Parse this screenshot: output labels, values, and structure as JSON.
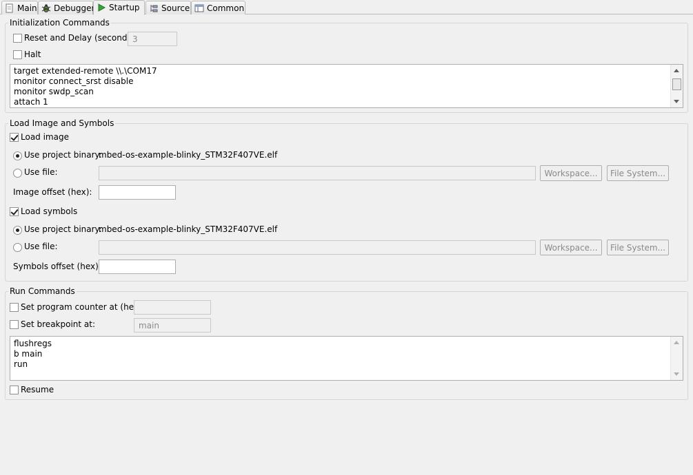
{
  "tabs": [
    {
      "label": "Main",
      "icon": "document-icon"
    },
    {
      "label": "Debugger",
      "icon": "bug-icon"
    },
    {
      "label": "Startup",
      "icon": "play-icon"
    },
    {
      "label": "Source",
      "icon": "source-icon"
    },
    {
      "label": "Common",
      "icon": "window-icon"
    }
  ],
  "init": {
    "title": "Initialization Commands",
    "reset_label": "Reset and Delay (seconds):",
    "reset_value": "3",
    "halt_label": "Halt",
    "commands": [
      "target extended-remote \\\\.\\COM17",
      "monitor connect_srst disable",
      "monitor swdp_scan",
      "attach 1"
    ]
  },
  "load": {
    "title": "Load Image and Symbols",
    "load_image_label": "Load image",
    "use_project_binary_label": "Use project binary:",
    "image_binary": "mbed-os-example-blinky_STM32F407VE.elf",
    "use_file_label": "Use file:",
    "workspace_label": "Workspace...",
    "filesystem_label": "File System...",
    "image_offset_label": "Image offset (hex):",
    "load_symbols_label": "Load symbols",
    "symbols_binary": "mbed-os-example-blinky_STM32F407VE.elf",
    "symbols_offset_label": "Symbols offset (hex):"
  },
  "run": {
    "title": "Run Commands",
    "pc_label": "Set program counter at (hex):",
    "bp_label": "Set breakpoint at:",
    "bp_value": "main",
    "commands": [
      "flushregs",
      "b main",
      "run"
    ],
    "resume_label": "Resume"
  },
  "colors": {
    "background": "#f0f0f0",
    "play_icon": "#3aa53a"
  }
}
